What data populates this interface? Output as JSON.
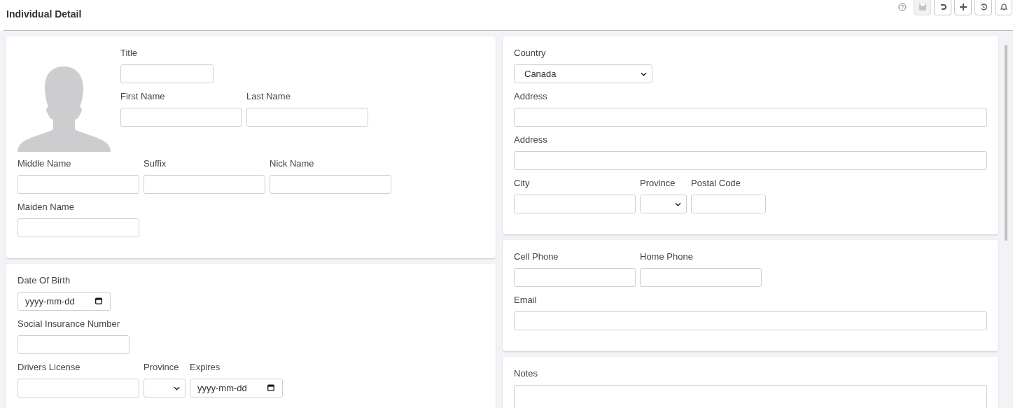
{
  "header": {
    "title": "Individual Detail",
    "toolbar": [
      {
        "kind": "help",
        "disabled": false
      },
      {
        "kind": "save",
        "disabled": true
      },
      {
        "kind": "undo",
        "disabled": false
      },
      {
        "kind": "add",
        "disabled": false
      },
      {
        "kind": "history",
        "disabled": false
      },
      {
        "kind": "bell",
        "disabled": false
      }
    ]
  },
  "columns": [
    {
      "cards": [
        {
          "kind": "profile",
          "rows": [
            {
              "fields": [
                {
                  "label": "Title",
                  "kind": "text"
                }
              ]
            },
            {
              "fields": [
                {
                  "label": "First Name",
                  "kind": "text"
                },
                {
                  "label": "Last Name",
                  "kind": "text"
                }
              ]
            },
            {
              "fields": [
                {
                  "label": "Middle Name",
                  "kind": "text"
                },
                {
                  "label": "Suffix",
                  "kind": "text"
                },
                {
                  "label": "Nick Name",
                  "kind": "text"
                }
              ]
            },
            {
              "fields": [
                {
                  "label": "Maiden Name",
                  "kind": "text"
                }
              ]
            }
          ]
        },
        {
          "kind": "form",
          "rows": [
            {
              "fields": [
                {
                  "label": "Date Of Birth",
                  "kind": "date",
                  "placeholder": "yyyy-mm-dd"
                }
              ]
            },
            {
              "fields": [
                {
                  "label": "Social Insurance Number",
                  "kind": "text"
                }
              ]
            },
            {
              "fields": [
                {
                  "label": "Drivers License",
                  "kind": "text"
                },
                {
                  "label": "Province",
                  "kind": "select"
                },
                {
                  "label": "Expires",
                  "kind": "date",
                  "placeholder": "yyyy-mm-dd"
                }
              ]
            }
          ]
        }
      ]
    },
    {
      "cards": [
        {
          "kind": "form",
          "rows": [
            {
              "fields": [
                {
                  "label": "Country",
                  "kind": "select",
                  "value": "Canada"
                }
              ]
            },
            {
              "fields": [
                {
                  "label": "Address",
                  "kind": "text"
                }
              ]
            },
            {
              "fields": [
                {
                  "label": "Address",
                  "kind": "text"
                }
              ]
            },
            {
              "fields": [
                {
                  "label": "City",
                  "kind": "text"
                },
                {
                  "label": "Province",
                  "kind": "select"
                },
                {
                  "label": "Postal Code",
                  "kind": "text"
                }
              ]
            }
          ]
        },
        {
          "kind": "form",
          "rows": [
            {
              "fields": [
                {
                  "label": "Cell Phone",
                  "kind": "text"
                },
                {
                  "label": "Home Phone",
                  "kind": "text"
                }
              ]
            },
            {
              "fields": [
                {
                  "label": "Email",
                  "kind": "text"
                }
              ]
            }
          ]
        },
        {
          "kind": "form",
          "rows": [
            {
              "fields": [
                {
                  "label": "Notes",
                  "kind": "textarea"
                }
              ]
            }
          ]
        }
      ]
    }
  ]
}
